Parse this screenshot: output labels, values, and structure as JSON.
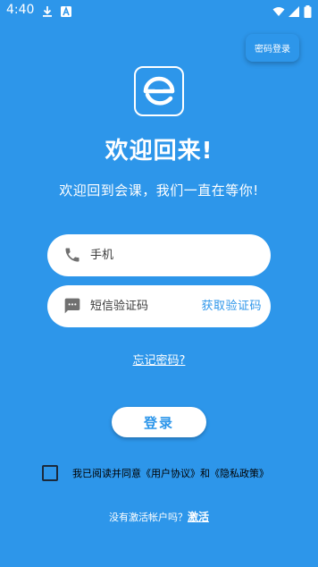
{
  "status_bar": {
    "time": "4:40",
    "icons": [
      "download-icon",
      "text-a-icon",
      "wifi-icon",
      "signal-icon",
      "battery-icon"
    ]
  },
  "top_action": {
    "password_login_label": "密码登录"
  },
  "logo": {
    "icon": "logo-icon"
  },
  "welcome": {
    "title": "欢迎回来!",
    "subtitle": "欢迎回到会课，我们一直在等你!"
  },
  "form": {
    "phone": {
      "icon": "phone-icon",
      "placeholder": "手机",
      "value": ""
    },
    "sms": {
      "icon": "message-icon",
      "placeholder": "短信验证码",
      "value": "",
      "get_code_label": "获取验证码"
    },
    "forgot_password_label": "忘记密码?",
    "login_label": "登录"
  },
  "agreement": {
    "checked": false,
    "prefix": "我已阅读并同意",
    "user_agreement": "《用户协议》",
    "and": "和",
    "privacy_policy": "《隐私政策》"
  },
  "activate": {
    "prompt": "没有激活帐户吗？",
    "link_label": "激活"
  },
  "colors": {
    "background": "#2d96ea",
    "accent": "#2d96ea",
    "white": "#ffffff"
  }
}
